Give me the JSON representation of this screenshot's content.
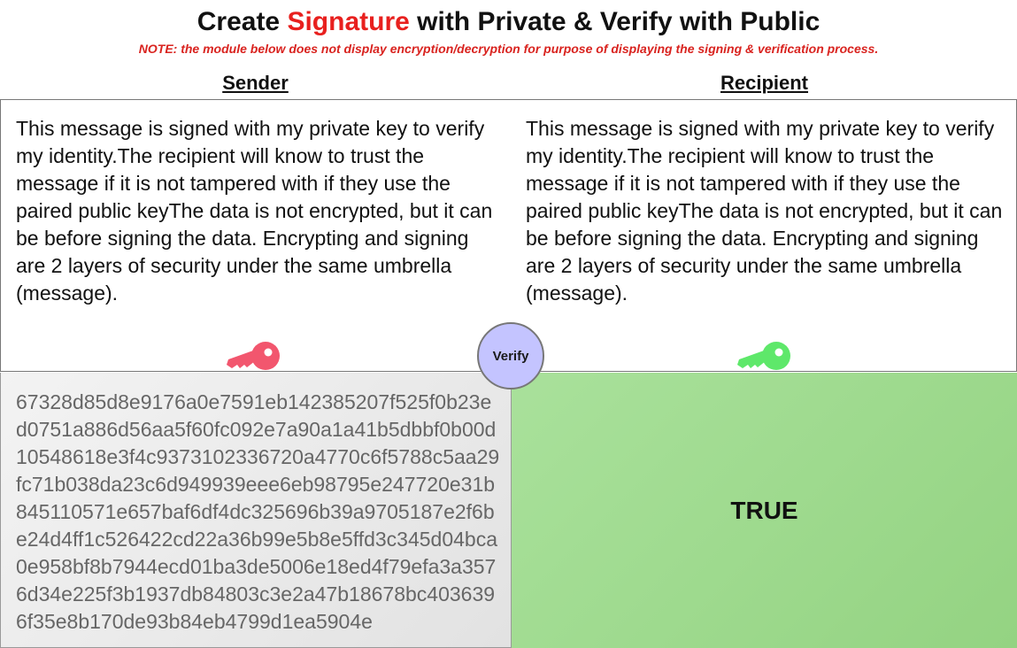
{
  "header": {
    "title_pre": "Create ",
    "title_accent": "Signature",
    "title_post": " with Private & Verify with Public",
    "accent_color": "#e8201e",
    "note": "NOTE: the module below does not display encryption/decryption for purpose of displaying the signing & verification process."
  },
  "sender": {
    "heading": "Sender",
    "message": "This message is signed with my private key to verify my identity.The recipient will know to trust the message if it is not tampered with if they use the paired public keyThe data is not encrypted, but it can be before signing the data. Encrypting and signing are 2 layers of security under the same umbrella (message).",
    "key_icon": "private-key-icon",
    "key_color": "#f2566e",
    "signature": "67328d85d8e9176a0e7591eb142385207f525f0b23ed0751a886d56aa5f60fc092e7a90a1a41b5dbbf0b00d10548618e3f4c9373102336720a4770c6f5788c5aa29fc71b038da23c6d949939eee6eb98795e247720e31b845110571e657baf6df4dc325696b39a9705187e2f6be24d4ff1c526422cd22a36b99e5b8e5ffd3c345d04bca0e958bf8b7944ecd01ba3de5006e18ed4f79efa3a3576d34e225f3b1937db84803c3e2a47b18678bc4036396f35e8b170de93b84eb4799d1ea5904e"
  },
  "recipient": {
    "heading": "Recipient",
    "message": "This message is signed with my private key to verify my identity.The recipient will know to trust the message if it is not tampered with if they use the paired public keyThe data is not encrypted, but it can be before signing the data. Encrypting and signing are 2 layers of security under the same umbrella (message).",
    "key_icon": "public-key-icon",
    "key_color": "#5ee86a",
    "result": "TRUE",
    "result_color": "#a2dc92"
  },
  "verify_button": {
    "label": "Verify",
    "color": "#c4c4ff"
  }
}
